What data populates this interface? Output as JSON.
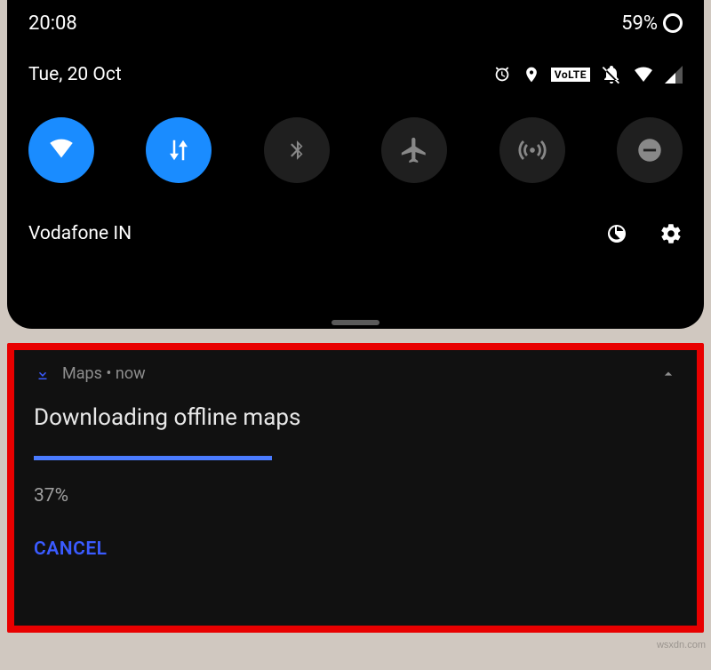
{
  "status": {
    "time": "20:08",
    "battery_text": "59%"
  },
  "header": {
    "date": "Tue, 20 Oct",
    "volte": "VoLTE"
  },
  "qs": {
    "tiles": [
      {
        "name": "wifi",
        "active": true
      },
      {
        "name": "mobile-data",
        "active": true
      },
      {
        "name": "bluetooth",
        "active": false
      },
      {
        "name": "airplane",
        "active": false
      },
      {
        "name": "hotspot",
        "active": false
      },
      {
        "name": "dnd",
        "active": false
      }
    ]
  },
  "footer": {
    "carrier": "Vodafone IN"
  },
  "notification": {
    "app": "Maps",
    "sep": " • ",
    "time": "now",
    "title": "Downloading offline maps",
    "progress_percent": 37,
    "progress_text": "37%",
    "cancel": "CANCEL"
  },
  "watermark": "wsxdn.com"
}
